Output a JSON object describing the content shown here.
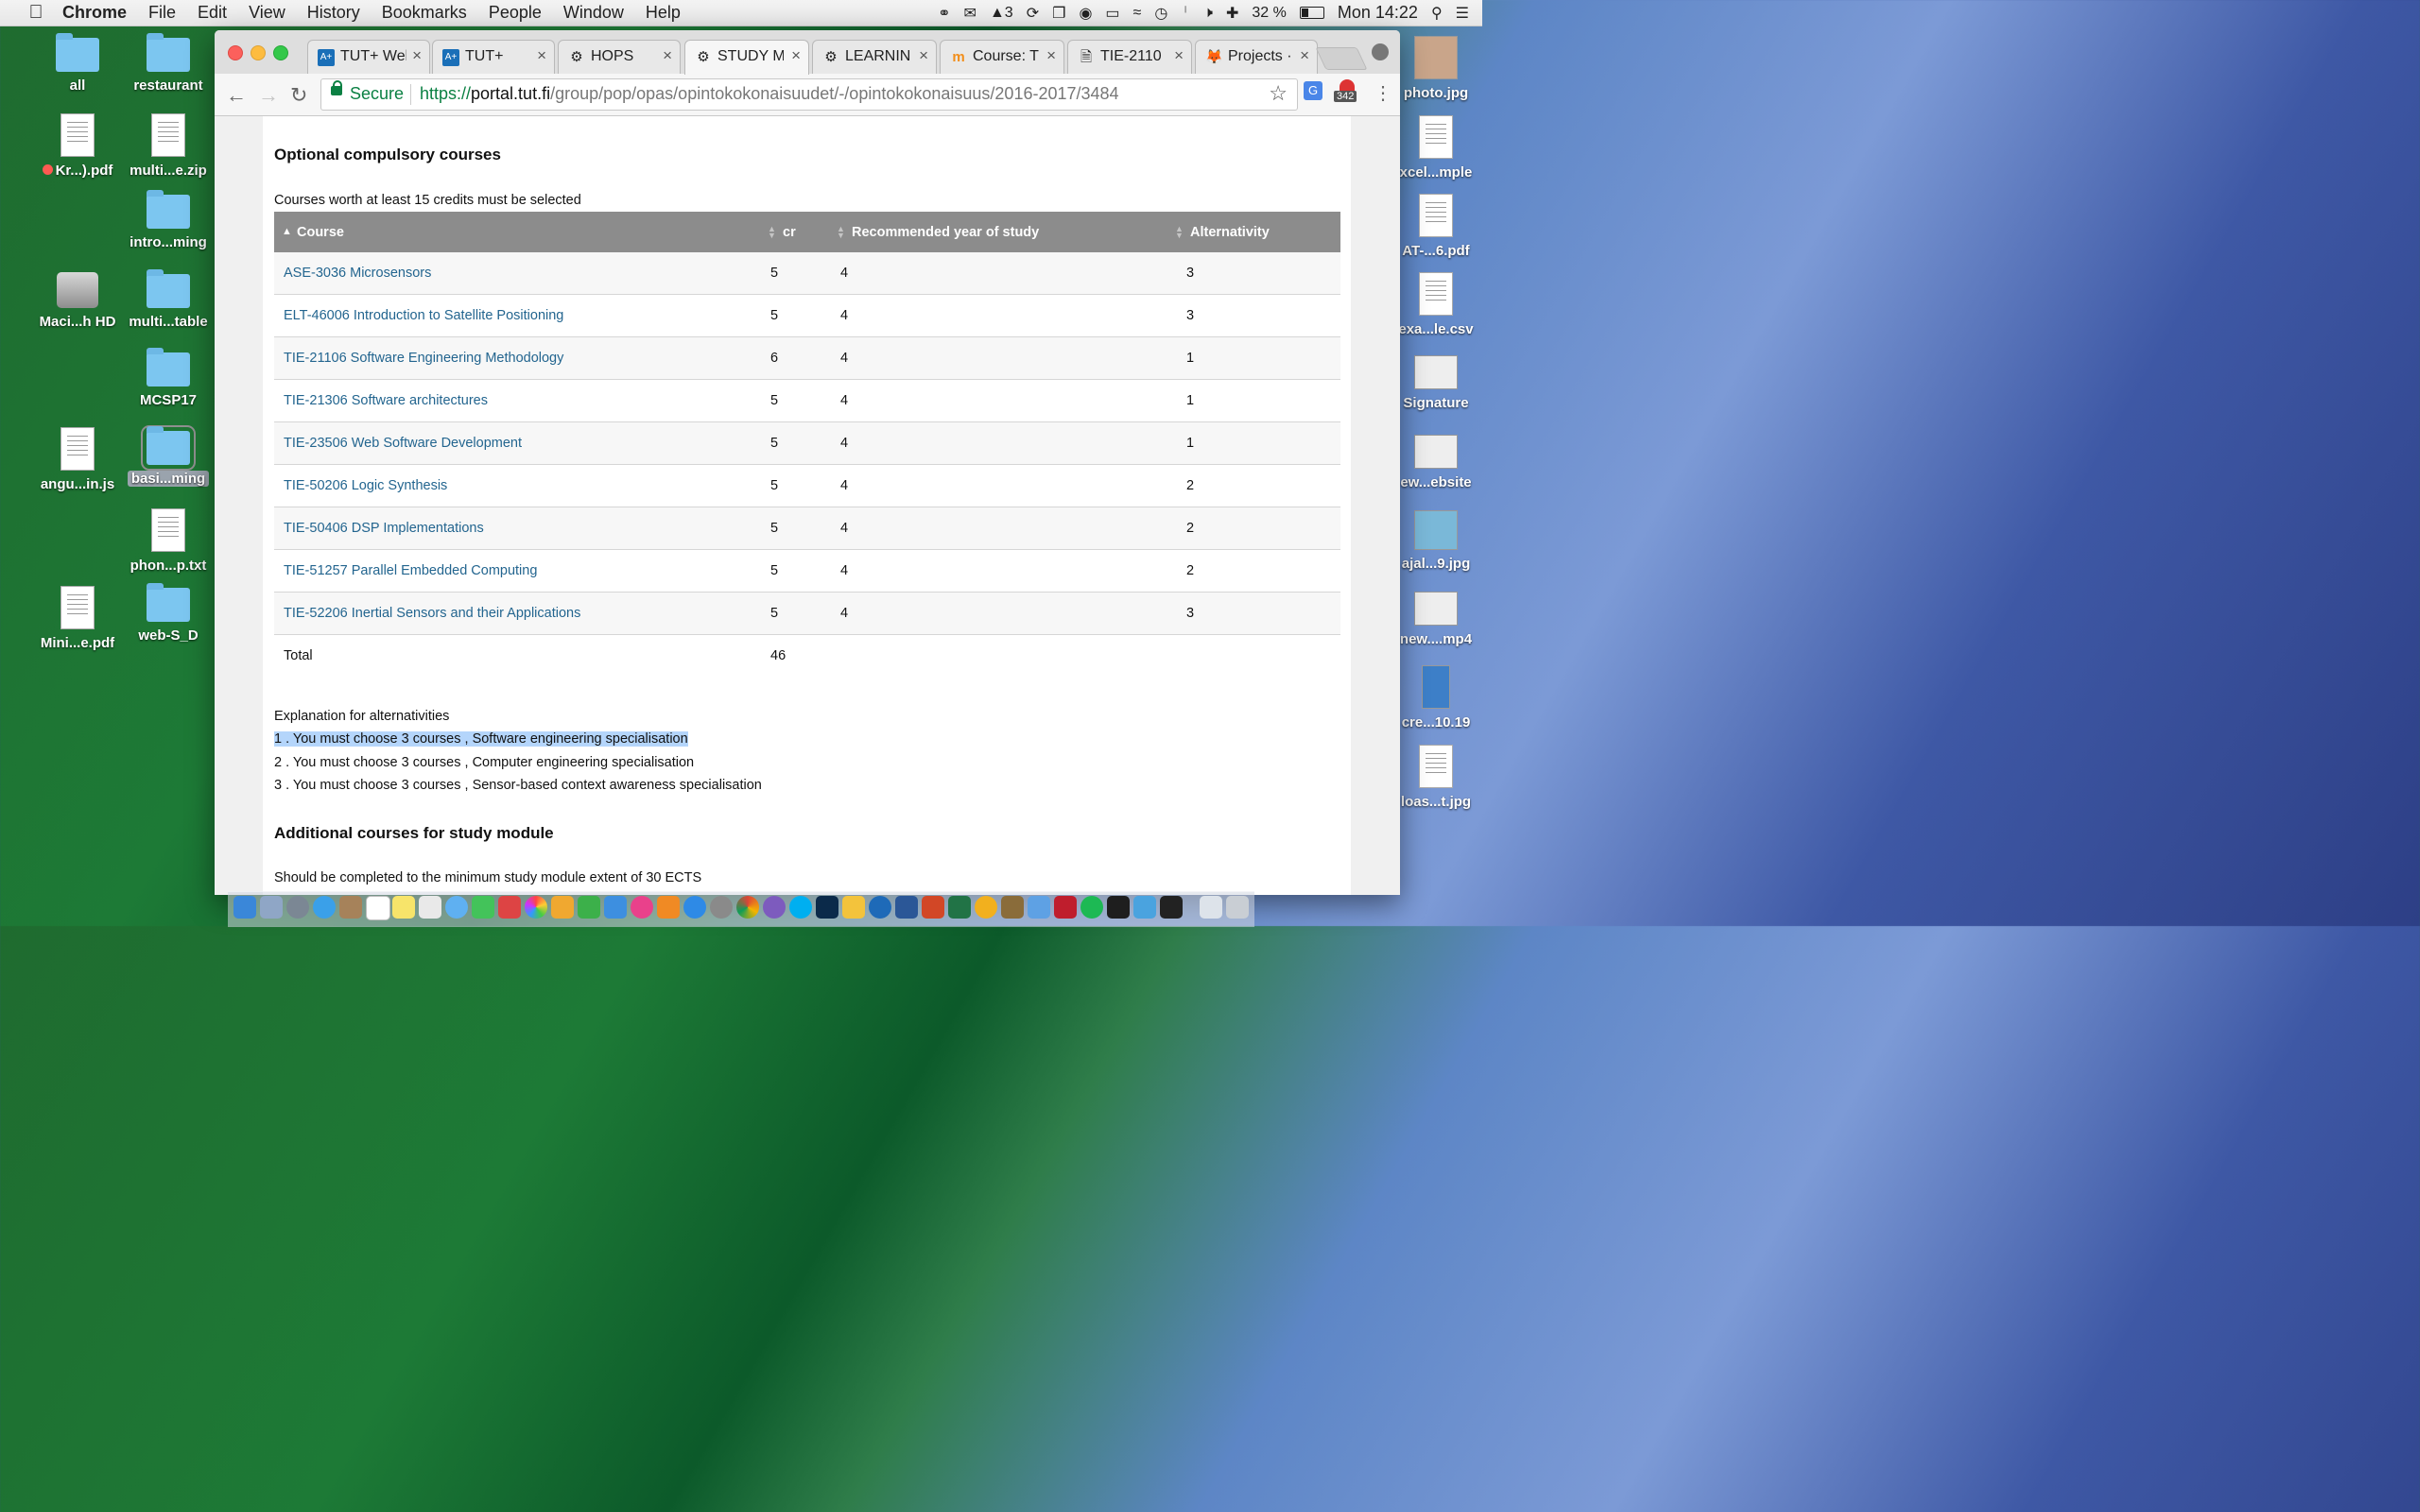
{
  "menubar": {
    "app": "Chrome",
    "items": [
      "File",
      "Edit",
      "View",
      "History",
      "Bookmarks",
      "People",
      "Window",
      "Help"
    ],
    "notif_count": "3",
    "battery": "32 %",
    "battery_level": 0.32,
    "clock": "Mon 14:22"
  },
  "desktop_left": [
    {
      "label": "all",
      "kind": "folder"
    },
    {
      "label": "restaurant",
      "kind": "folder"
    },
    {
      "label": "Kr...).pdf",
      "kind": "doc",
      "tag": true
    },
    {
      "label": "multi...e.zip",
      "kind": "zip"
    },
    {
      "label": "intro...ming",
      "kind": "folder"
    },
    {
      "label": "Maci...h HD",
      "kind": "disk"
    },
    {
      "label": "multi...table",
      "kind": "folder"
    },
    {
      "label": "MCSP17",
      "kind": "folder"
    },
    {
      "label": "angu...in.js",
      "kind": "doc"
    },
    {
      "label": "basi...ming",
      "kind": "folder",
      "selected": true
    },
    {
      "label": "phon...p.txt",
      "kind": "doc"
    },
    {
      "label": "Mini...e.pdf",
      "kind": "doc"
    },
    {
      "label": "web-S_D",
      "kind": "folder"
    }
  ],
  "desktop_right": [
    {
      "label": "photo.jpg"
    },
    {
      "label": "xcel...mple"
    },
    {
      "label": "AT-...6.pdf"
    },
    {
      "label": "exa...le.csv"
    },
    {
      "label": "Signature"
    },
    {
      "label": "ew...ebsite"
    },
    {
      "label": "ajal...9.jpg"
    },
    {
      "label": "new....mp4"
    },
    {
      "label": "cre...10.19"
    },
    {
      "label": "loas...t.jpg"
    }
  ],
  "tabs": [
    {
      "title": "TUT+ Wel",
      "icon": "aplus-icon"
    },
    {
      "title": "TUT+",
      "icon": "aplus-icon"
    },
    {
      "title": "HOPS",
      "icon": "gear-icon"
    },
    {
      "title": "STUDY M",
      "icon": "gear-icon",
      "active": true
    },
    {
      "title": "LEARNIN",
      "icon": "gear-icon"
    },
    {
      "title": "Course: T",
      "icon": "moodle-icon"
    },
    {
      "title": "TIE-2110",
      "icon": "page-icon"
    },
    {
      "title": "Projects ·",
      "icon": "gitlab-icon"
    }
  ],
  "address": {
    "secure_label": "Secure",
    "scheme": "https://",
    "host": "portal.tut.fi",
    "path": "/group/pop/opas/opintokokonaisuudet/-/opintokokonaisuus/2016-2017/3484"
  },
  "extension_badge": "342",
  "page": {
    "section1_title": "Optional compulsory courses",
    "section1_note": "Courses worth at least 15 credits must be selected",
    "columns": {
      "course": "Course",
      "cr": "cr",
      "year": "Recommended year of study",
      "alt": "Alternativity"
    },
    "rows": [
      {
        "course": "ASE-3036 Microsensors",
        "cr": "5",
        "year": "4",
        "alt": "3"
      },
      {
        "course": "ELT-46006 Introduction to Satellite Positioning",
        "cr": "5",
        "year": "4",
        "alt": "3"
      },
      {
        "course": "TIE-21106 Software Engineering Methodology",
        "cr": "6",
        "year": "4",
        "alt": "1"
      },
      {
        "course": "TIE-21306 Software architectures",
        "cr": "5",
        "year": "4",
        "alt": "1"
      },
      {
        "course": "TIE-23506 Web Software Development",
        "cr": "5",
        "year": "4",
        "alt": "1"
      },
      {
        "course": "TIE-50206 Logic Synthesis",
        "cr": "5",
        "year": "4",
        "alt": "2"
      },
      {
        "course": "TIE-50406 DSP Implementations",
        "cr": "5",
        "year": "4",
        "alt": "2"
      },
      {
        "course": "TIE-51257 Parallel Embedded Computing",
        "cr": "5",
        "year": "4",
        "alt": "2"
      },
      {
        "course": "TIE-52206 Inertial Sensors and their Applications",
        "cr": "5",
        "year": "4",
        "alt": "3"
      }
    ],
    "total_label": "Total",
    "total_cr": "46",
    "explanation_title": "Explanation for alternativities",
    "explanations": [
      "1 . You must choose 3 courses , Software engineering specialisation",
      "2 . You must choose 3 courses , Computer engineering specialisation",
      "3 . You must choose 3 courses , Sensor-based context awareness specialisation"
    ],
    "section2_title": "Additional courses for study module",
    "section2_note": "Should be completed to the minimum study module extent of 30 ECTS"
  },
  "colors": {
    "link": "#23658f",
    "header_bg": "#8c8c8c",
    "secure_green": "#0b8043",
    "selection": "#b4d5fb"
  }
}
